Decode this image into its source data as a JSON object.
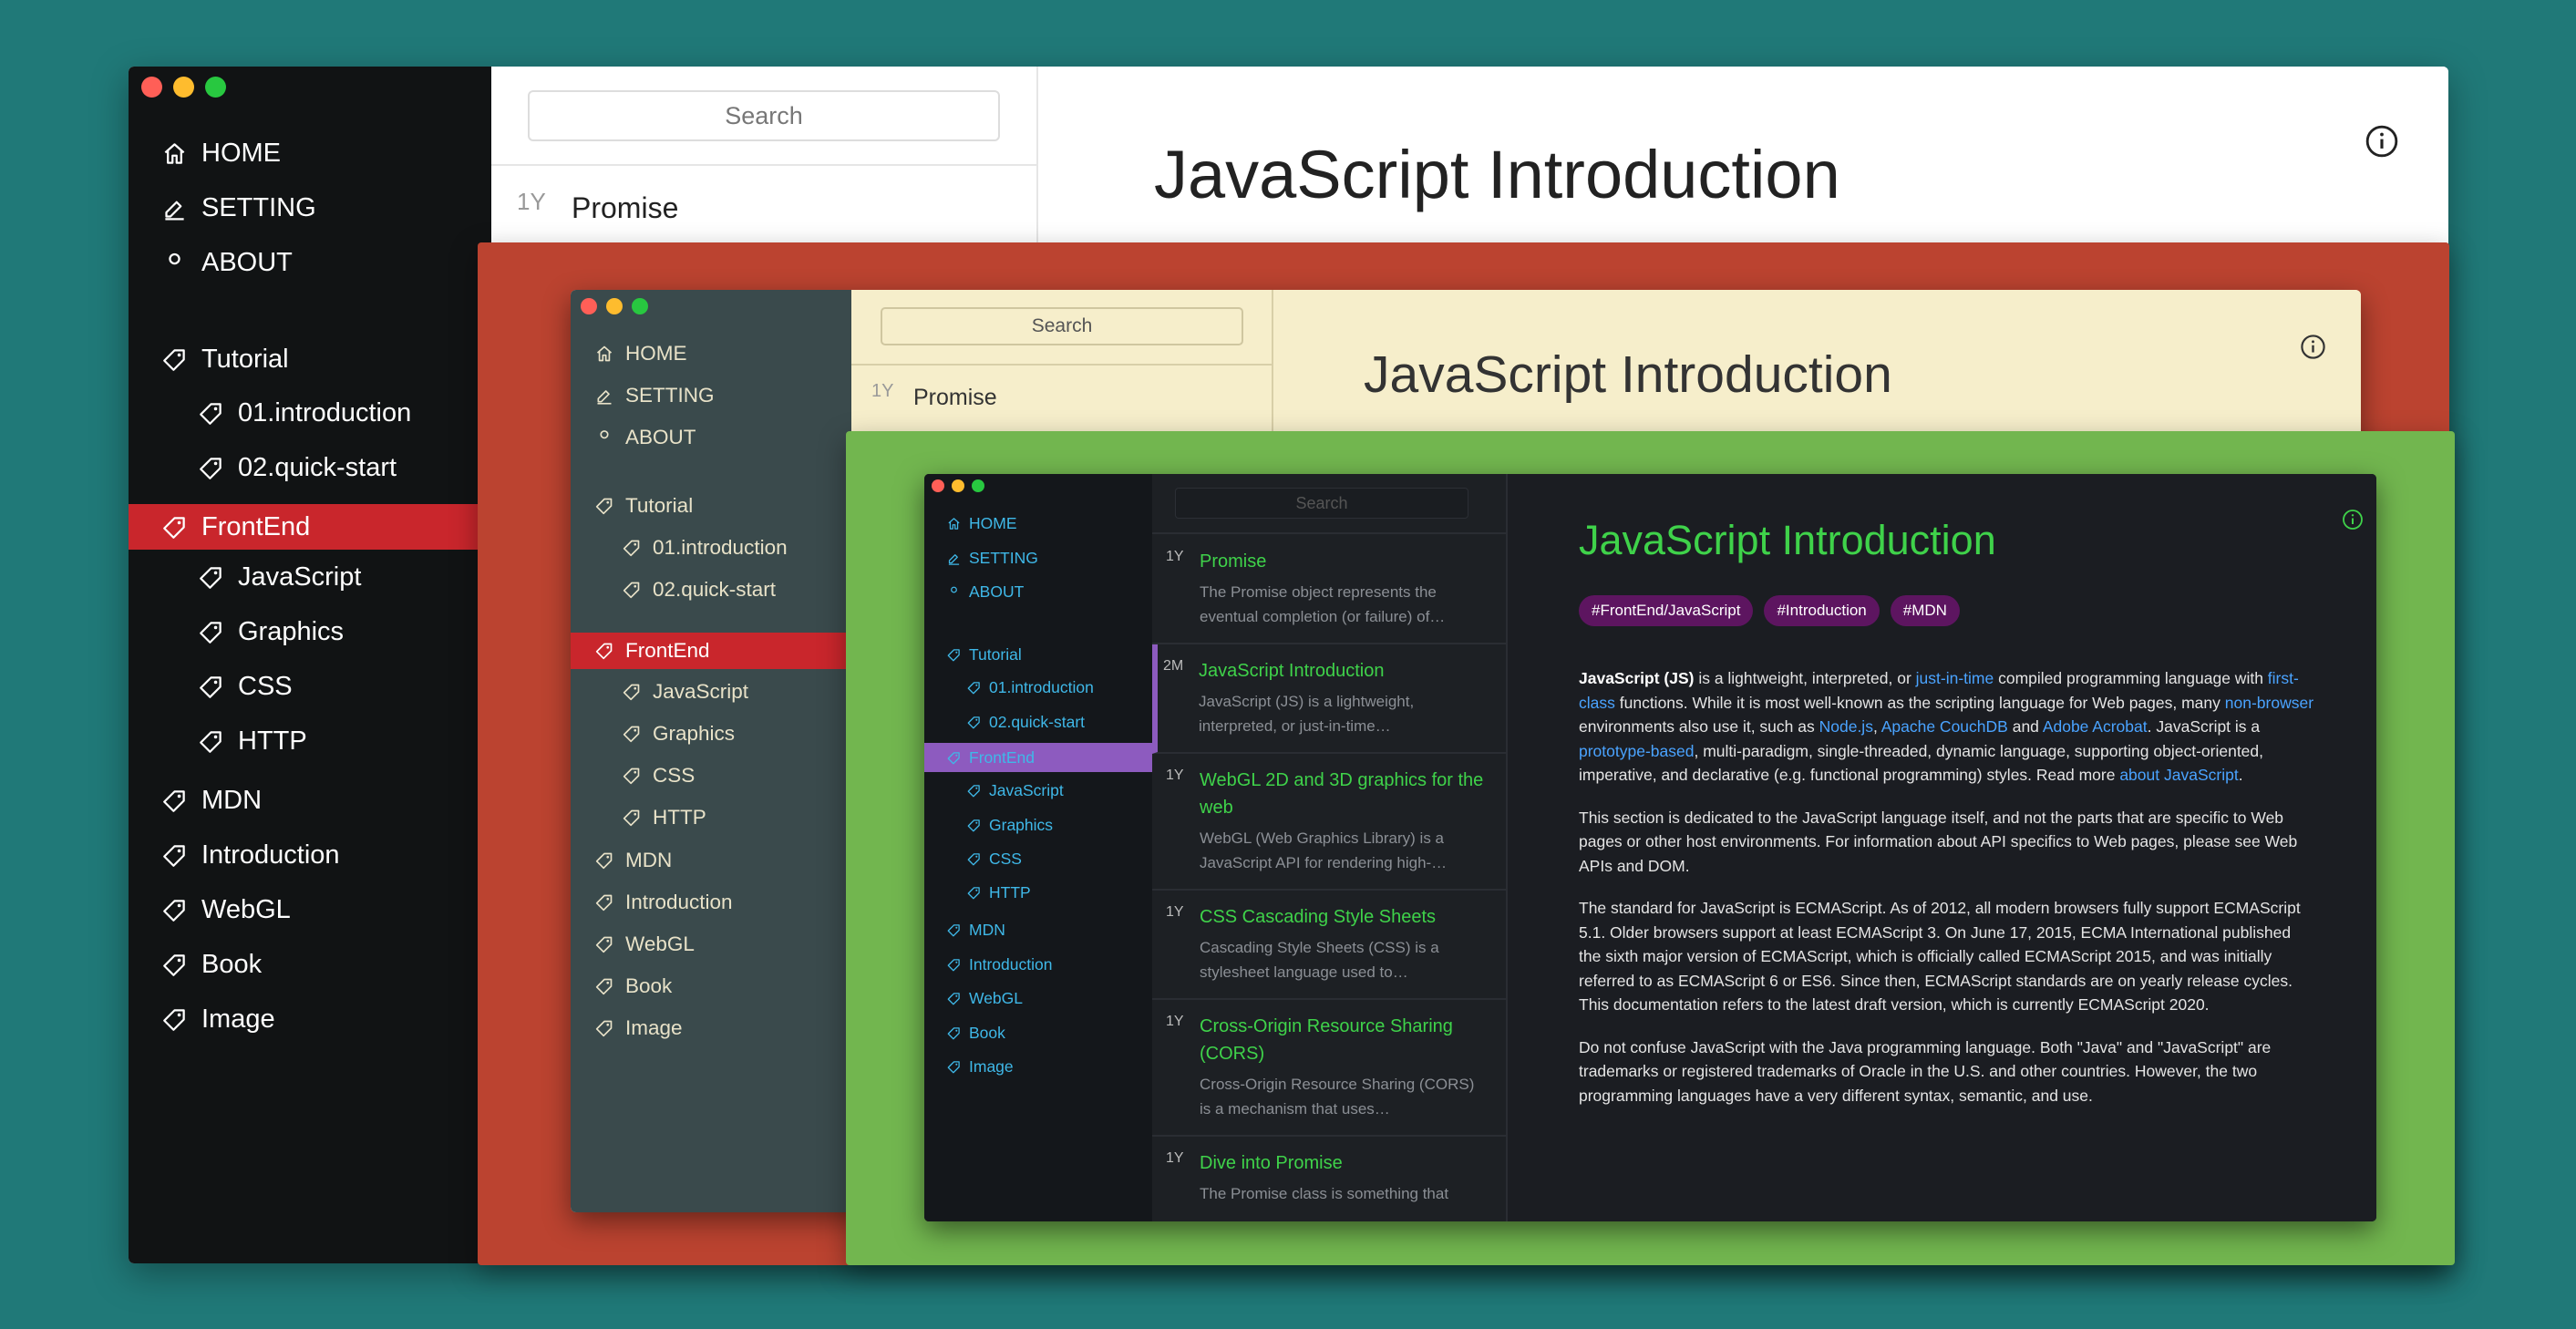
{
  "colors": {
    "background": "#207978",
    "frame_red": "#bb4330",
    "frame_green": "#72b64f",
    "active_red": "#c9262c",
    "active_purple": "#8d5bbf",
    "light_red": "#ff5f57",
    "light_yellow": "#febc2e",
    "light_green": "#28c840"
  },
  "window_large": {
    "nav": [
      {
        "label": "HOME",
        "icon": "home-icon"
      },
      {
        "label": "SETTING",
        "icon": "setting-icon"
      },
      {
        "label": "ABOUT",
        "icon": "user-icon"
      },
      {
        "label": "Tutorial",
        "icon": "tag-icon"
      },
      {
        "label": "01.introduction",
        "icon": "tag-icon"
      },
      {
        "label": "02.quick-start",
        "icon": "tag-icon"
      },
      {
        "label": "FrontEnd",
        "icon": "tag-icon",
        "active": true
      },
      {
        "label": "JavaScript",
        "icon": "tag-icon"
      },
      {
        "label": "Graphics",
        "icon": "tag-icon"
      },
      {
        "label": "CSS",
        "icon": "tag-icon"
      },
      {
        "label": "HTTP",
        "icon": "tag-icon"
      },
      {
        "label": "MDN",
        "icon": "tag-icon"
      },
      {
        "label": "Introduction",
        "icon": "tag-icon"
      },
      {
        "label": "WebGL",
        "icon": "tag-icon"
      },
      {
        "label": "Book",
        "icon": "tag-icon"
      },
      {
        "label": "Image",
        "icon": "tag-icon"
      }
    ],
    "search_placeholder": "Search",
    "list": [
      {
        "age": "1Y",
        "title": "Promise"
      }
    ],
    "title": "JavaScript Introduction"
  },
  "window_medium": {
    "nav": [
      {
        "label": "HOME",
        "icon": "home-icon"
      },
      {
        "label": "SETTING",
        "icon": "setting-icon"
      },
      {
        "label": "ABOUT",
        "icon": "user-icon"
      },
      {
        "label": "Tutorial",
        "icon": "tag-icon"
      },
      {
        "label": "01.introduction",
        "icon": "tag-icon"
      },
      {
        "label": "02.quick-start",
        "icon": "tag-icon"
      },
      {
        "label": "FrontEnd",
        "icon": "tag-icon",
        "active": true
      },
      {
        "label": "JavaScript",
        "icon": "tag-icon"
      },
      {
        "label": "Graphics",
        "icon": "tag-icon"
      },
      {
        "label": "CSS",
        "icon": "tag-icon"
      },
      {
        "label": "HTTP",
        "icon": "tag-icon"
      },
      {
        "label": "MDN",
        "icon": "tag-icon"
      },
      {
        "label": "Introduction",
        "icon": "tag-icon"
      },
      {
        "label": "WebGL",
        "icon": "tag-icon"
      },
      {
        "label": "Book",
        "icon": "tag-icon"
      },
      {
        "label": "Image",
        "icon": "tag-icon"
      }
    ],
    "search_placeholder": "Search",
    "list": [
      {
        "age": "1Y",
        "title": "Promise"
      }
    ],
    "title": "JavaScript Introduction"
  },
  "window_small": {
    "nav": [
      {
        "label": "HOME",
        "icon": "home-icon"
      },
      {
        "label": "SETTING",
        "icon": "setting-icon"
      },
      {
        "label": "ABOUT",
        "icon": "user-icon"
      },
      {
        "label": "Tutorial",
        "icon": "tag-icon"
      },
      {
        "label": "01.introduction",
        "icon": "tag-icon"
      },
      {
        "label": "02.quick-start",
        "icon": "tag-icon"
      },
      {
        "label": "FrontEnd",
        "icon": "tag-icon",
        "active": true
      },
      {
        "label": "JavaScript",
        "icon": "tag-icon"
      },
      {
        "label": "Graphics",
        "icon": "tag-icon"
      },
      {
        "label": "CSS",
        "icon": "tag-icon"
      },
      {
        "label": "HTTP",
        "icon": "tag-icon"
      },
      {
        "label": "MDN",
        "icon": "tag-icon"
      },
      {
        "label": "Introduction",
        "icon": "tag-icon"
      },
      {
        "label": "WebGL",
        "icon": "tag-icon"
      },
      {
        "label": "Book",
        "icon": "tag-icon"
      },
      {
        "label": "Image",
        "icon": "tag-icon"
      }
    ],
    "search_placeholder": "Search",
    "list": [
      {
        "age": "1Y",
        "title": "Promise",
        "excerpt": "The Promise object represents the eventual completion (or failure) of…"
      },
      {
        "age": "2M",
        "title": "JavaScript Introduction",
        "excerpt": "JavaScript (JS) is a lightweight, interpreted, or just-in-time…",
        "selected": true
      },
      {
        "age": "1Y",
        "title": "WebGL 2D and 3D graphics for the web",
        "excerpt": "WebGL (Web Graphics Library) is a JavaScript API for rendering high-…"
      },
      {
        "age": "1Y",
        "title": "CSS Cascading Style Sheets",
        "excerpt": "Cascading Style Sheets (CSS) is a stylesheet language used to…"
      },
      {
        "age": "1Y",
        "title": "Cross-Origin Resource Sharing (CORS)",
        "excerpt": "Cross-Origin Resource Sharing (CORS) is a mechanism that uses…"
      },
      {
        "age": "1Y",
        "title": "Dive into Promise",
        "excerpt": "The Promise class is something that"
      }
    ],
    "title": "JavaScript Introduction",
    "tags": [
      "#FrontEnd/JavaScript",
      "#Introduction",
      "#MDN"
    ],
    "p1": [
      {
        "t": "JavaScript (JS)",
        "s": "b"
      },
      {
        "t": " is a lightweight, interpreted, or "
      },
      {
        "t": "just-in-time",
        "s": "a"
      },
      {
        "t": " compiled programming language with "
      },
      {
        "t": "first-class",
        "s": "a"
      },
      {
        "t": " functions. While it is most well-known as the scripting language for Web pages, many "
      },
      {
        "t": "non-browser",
        "s": "a"
      },
      {
        "t": " environments also use it, such as "
      },
      {
        "t": "Node.js",
        "s": "a"
      },
      {
        "t": ", "
      },
      {
        "t": "Apache CouchDB",
        "s": "a"
      },
      {
        "t": " and "
      },
      {
        "t": "Adobe Acrobat",
        "s": "a"
      },
      {
        "t": ". JavaScript is a "
      },
      {
        "t": "prototype-based",
        "s": "a"
      },
      {
        "t": ", multi-paradigm, single-threaded, dynamic language, supporting object-oriented, imperative, and declarative (e.g. functional programming) styles. Read more "
      },
      {
        "t": "about JavaScript",
        "s": "a"
      },
      {
        "t": "."
      }
    ],
    "p2": "This section is dedicated to the JavaScript language itself, and not the parts that are specific to Web pages or other host environments. For information about API specifics to Web pages, please see Web APIs and DOM.",
    "p3": "The standard for JavaScript is ECMAScript. As of 2012, all modern browsers fully support ECMAScript 5.1. Older browsers support at least ECMAScript 3. On June 17, 2015, ECMA International published the sixth major version of ECMAScript, which is officially called ECMAScript 2015, and was initially referred to as ECMAScript 6 or ES6. Since then, ECMAScript standards are on yearly release cycles. This documentation refers to the latest draft version, which is currently ECMAScript 2020.",
    "p4": "Do not confuse JavaScript with the Java programming language. Both \"Java\" and \"JavaScript\" are trademarks or registered trademarks of Oracle in the U.S. and other countries. However, the two programming languages have a very different syntax, semantic, and use."
  }
}
